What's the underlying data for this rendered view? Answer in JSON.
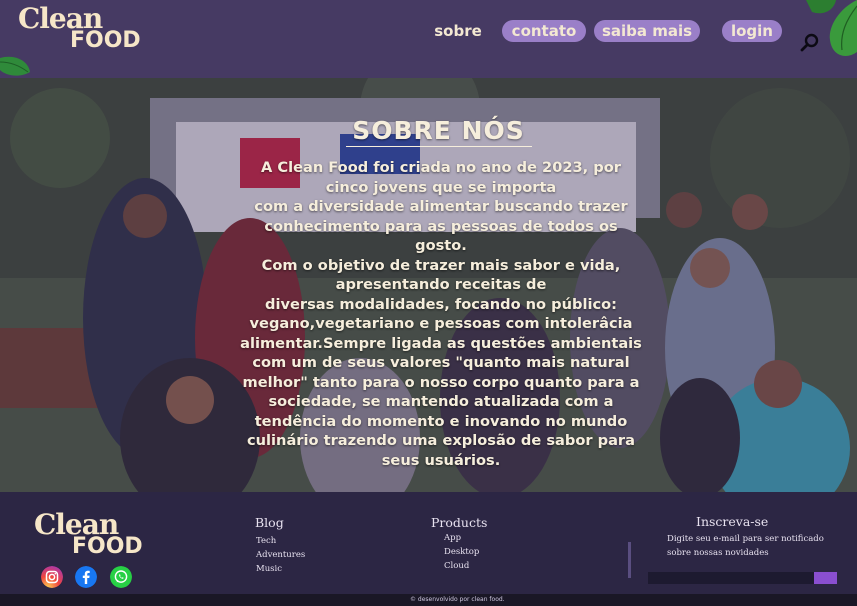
{
  "brand": {
    "line1": "Clean",
    "line2": "FOOD"
  },
  "nav": {
    "sobre": "sobre",
    "contato": "contato",
    "saiba_mais": "saiba mais",
    "login": "login"
  },
  "search": {
    "icon": "search-icon"
  },
  "hero": {
    "title": "SOBRE NÓS",
    "lines": [
      "A Clean Food foi criada no ano de 2023, por",
      "cinco jovens que se importa",
      "com a diversidade alimentar buscando trazer",
      "conhecimento para as pessoas de todos os",
      "gosto.",
      "Com o objetivo de trazer mais sabor e vida,",
      "apresentando receitas de",
      "diversas modalidades, focando no público:",
      "vegano,vegetariano e pessoas com intolerâcia",
      "alimentar.Sempre ligada as questões ambientais",
      "com um de seus valores \"quanto mais natural",
      "melhor\" tanto para o nosso corpo quanto para a",
      "sociedade, se mantendo atualizada com a",
      "tendência do momento e inovando no mundo",
      "culinário trazendo uma explosão de sabor para",
      "seus usuários."
    ]
  },
  "footer": {
    "blog": {
      "title": "Blog",
      "links": [
        "Tech",
        "Adventures",
        "Music"
      ]
    },
    "products": {
      "title": "Products",
      "links": [
        "App",
        "Desktop",
        "Cloud"
      ]
    },
    "newsletter": {
      "title": "Inscreva-se",
      "text1": "Digite seu e-mail para ser notificado",
      "text2": "sobre nossas novidades"
    },
    "social": [
      "instagram-icon",
      "facebook-icon",
      "whatsapp-icon"
    ]
  },
  "copyright": "desenvolvido por clean food.",
  "colors": {
    "header": "#463a63",
    "pill": "#9a7fc8",
    "footer": "#2c2644",
    "accent": "#8a4fd0"
  }
}
